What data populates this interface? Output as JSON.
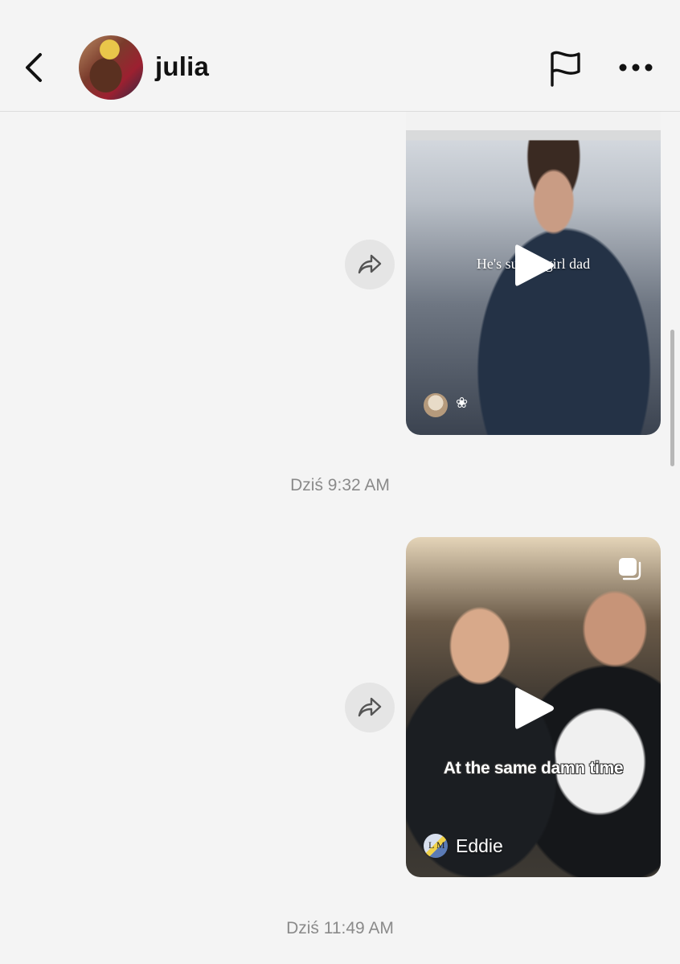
{
  "header": {
    "username": "julia"
  },
  "messages": [
    {
      "caption": "He's such a girl dad"
    },
    {
      "caption": "At the same damn time",
      "author": "Eddie",
      "author_avatar_text": "L M"
    }
  ],
  "timestamps": [
    "Dziś 9:32 AM",
    "Dziś 11:49 AM"
  ],
  "icons": {
    "back": "chevron-left-icon",
    "flag": "flag-icon",
    "more": "more-horizontal-icon",
    "share": "share-arrow-icon",
    "play": "play-icon",
    "multi": "multi-photo-icon"
  }
}
